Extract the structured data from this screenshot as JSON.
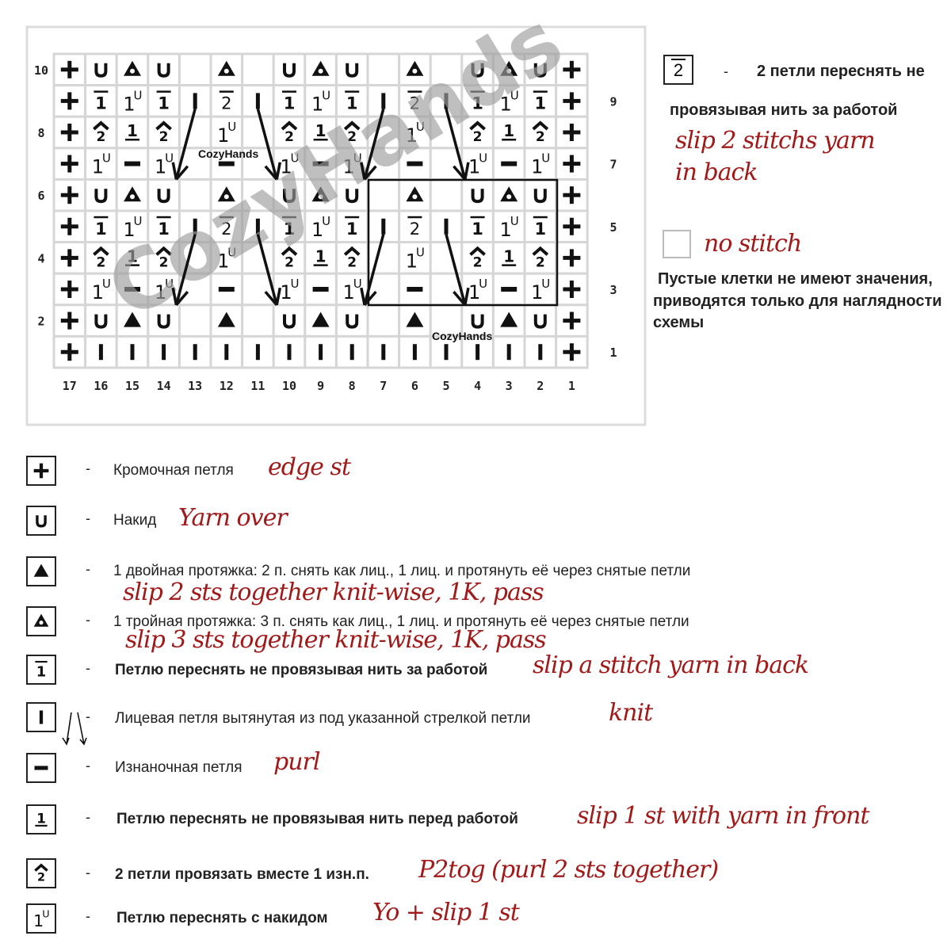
{
  "chart_data": {
    "type": "table",
    "columns": [
      "17",
      "16",
      "15",
      "14",
      "13",
      "12",
      "11",
      "10",
      "9",
      "8",
      "7",
      "6",
      "5",
      "4",
      "3",
      "2",
      "1"
    ],
    "row_labels_left": [
      "10",
      "8",
      "6",
      "4",
      "2"
    ],
    "row_labels_right": [
      "9",
      "7",
      "5",
      "3",
      "1"
    ],
    "rows": [
      {
        "row": 10,
        "cells": [
          "+",
          "U",
          "T3",
          "U",
          "",
          "T3",
          "",
          "U",
          "T3",
          "U",
          "",
          "T3",
          "",
          "U",
          "T3",
          "U",
          "+"
        ]
      },
      {
        "row": 9,
        "cells": [
          "+",
          "S1",
          "Y",
          "S1",
          "K",
          "S2",
          "K",
          "S1",
          "Y",
          "S1",
          "K",
          "S2",
          "K",
          "S1",
          "Y",
          "S1",
          "+"
        ]
      },
      {
        "row": 8,
        "cells": [
          "+",
          "P2",
          "F",
          "P2",
          "",
          "Y",
          "",
          "P2",
          "F",
          "P2",
          "",
          "Y",
          "",
          "P2",
          "F",
          "P2",
          "+"
        ]
      },
      {
        "row": 7,
        "cells": [
          "+",
          "Y",
          "-",
          "Y",
          "",
          "-",
          "",
          "Y",
          "-",
          "Y",
          "",
          "-",
          "",
          "Y",
          "-",
          "Y",
          "+"
        ]
      },
      {
        "row": 6,
        "cells": [
          "+",
          "U",
          "T3",
          "U",
          "",
          "T3",
          "",
          "U",
          "T3",
          "U",
          "",
          "T3",
          "",
          "U",
          "T3",
          "U",
          "+"
        ]
      },
      {
        "row": 5,
        "cells": [
          "+",
          "S1",
          "Y",
          "S1",
          "K",
          "S2",
          "K",
          "S1",
          "Y",
          "S1",
          "K",
          "S2",
          "K",
          "S1",
          "Y",
          "S1",
          "+"
        ]
      },
      {
        "row": 4,
        "cells": [
          "+",
          "P2",
          "F",
          "P2",
          "",
          "Y",
          "",
          "P2",
          "F",
          "P2",
          "",
          "Y",
          "",
          "P2",
          "F",
          "P2",
          "+"
        ]
      },
      {
        "row": 3,
        "cells": [
          "+",
          "Y",
          "-",
          "Y",
          "",
          "-",
          "",
          "Y",
          "-",
          "Y",
          "",
          "-",
          "",
          "Y",
          "-",
          "Y",
          "+"
        ]
      },
      {
        "row": 2,
        "cells": [
          "+",
          "U",
          "T2",
          "U",
          "",
          "T2",
          "",
          "U",
          "T2",
          "U",
          "",
          "T2",
          "",
          "U",
          "T2",
          "U",
          "+"
        ]
      },
      {
        "row": 1,
        "cells": [
          "+",
          "K",
          "K",
          "K",
          "K",
          "K",
          "K",
          "K",
          "K",
          "K",
          "K",
          "K",
          "K",
          "K",
          "K",
          "K",
          "+"
        ]
      }
    ],
    "repeat_box": {
      "columns": [
        "7",
        "1"
      ],
      "rows": [
        "6",
        "3"
      ]
    },
    "arrows": [
      {
        "from": {
          "row": 9,
          "col": 13
        },
        "to": {
          "row": 7,
          "col": 14
        }
      },
      {
        "from": {
          "row": 9,
          "col": 11
        },
        "to": {
          "row": 7,
          "col": 10
        }
      },
      {
        "from": {
          "row": 9,
          "col": 7
        },
        "to": {
          "row": 7,
          "col": 8
        }
      },
      {
        "from": {
          "row": 9,
          "col": 5
        },
        "to": {
          "row": 7,
          "col": 4
        }
      },
      {
        "from": {
          "row": 5,
          "col": 13
        },
        "to": {
          "row": 3,
          "col": 14
        }
      },
      {
        "from": {
          "row": 5,
          "col": 11
        },
        "to": {
          "row": 3,
          "col": 10
        }
      },
      {
        "from": {
          "row": 5,
          "col": 7
        },
        "to": {
          "row": 3,
          "col": 8
        }
      },
      {
        "from": {
          "row": 5,
          "col": 5
        },
        "to": {
          "row": 3,
          "col": 4
        }
      }
    ],
    "watermark": "CozyHands",
    "labels": [
      "CozyHands",
      "CozyHands"
    ]
  },
  "symbol_glyphs": {
    "Y_base": "1",
    "Y_sup": "U",
    "S1": "1",
    "S2": "2",
    "F": "1",
    "P2": "2",
    "U": "U"
  },
  "colors": {
    "grid": "#d6d6d6",
    "ink": "#111111",
    "red_text": "#a01a1a",
    "watermark": "#9e9e9e"
  },
  "side_legend": {
    "slip2": {
      "icon_glyph": "2",
      "ru_line1": "2 петли переснять не",
      "ru_line2": "провязывая нить за работой",
      "en_line1": "slip 2 stitchs yarn",
      "en_line2": "in back",
      "dash": "-"
    },
    "no_stitch": {
      "en": "no stitch",
      "ru_line1": "Пустые клетки не имеют значения,",
      "ru_line2": "приводятся только для наглядности",
      "ru_line3": "схемы"
    }
  },
  "legend": [
    {
      "icon": "edge-stitch-icon",
      "ru": "Кромочная петля",
      "en": "edge st"
    },
    {
      "icon": "yarn-over-icon",
      "ru": "Накид",
      "en": "Yarn over"
    },
    {
      "icon": "double-decrease-icon",
      "ru": "1 двойная протяжка: 2 п. снять как лиц., 1 лиц. и протянуть её  через снятые петли",
      "en": "slip 2 sts together knit-wise, 1K, pass"
    },
    {
      "icon": "triple-decrease-icon",
      "ru": "1 тройная протяжка: 3 п. снять как лиц., 1 лиц. и протянуть её  через снятые петли",
      "en": "slip 3 sts together knit-wise, 1K, pass"
    },
    {
      "icon": "slip-back-icon",
      "ru": "Петлю переснять не провязывая нить за работой",
      "en": "slip a stitch yarn in back"
    },
    {
      "icon": "knit-icon",
      "ru": "Лицевая петля вытянутая из под указанной стрелкой петли",
      "en": "knit"
    },
    {
      "icon": "purl-icon",
      "ru": "Изнаночная петля",
      "en": "purl"
    },
    {
      "icon": "slip-front-icon",
      "ru": "Петлю переснять не провязывая нить перед работой",
      "en": "slip 1 st with yarn in front"
    },
    {
      "icon": "p2tog-icon",
      "ru": "2 петли провязать вместе 1 изн.п.",
      "en": "P2tog (purl 2 sts together)"
    },
    {
      "icon": "yo-slip-icon",
      "ru": "Петлю переснять  с накидом",
      "en": "Yo + slip 1 st"
    }
  ],
  "legend_dash": "-"
}
